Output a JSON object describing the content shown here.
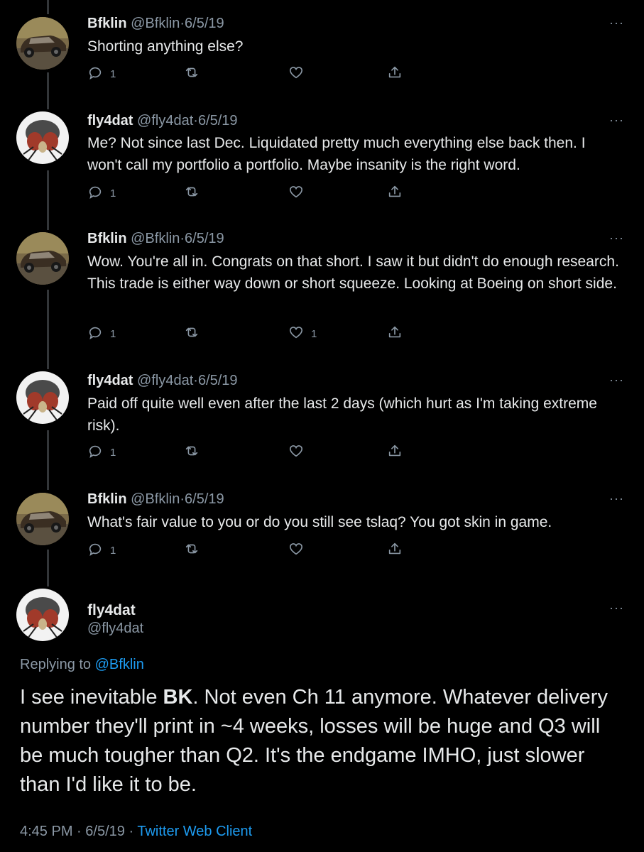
{
  "tweets": [
    {
      "name": "Bfklin",
      "handle": "@Bfklin",
      "date": "6/5/19",
      "text": "Shorting anything else?",
      "reply_count": "1",
      "retweet_count": "",
      "like_count": "",
      "avatar": "car"
    },
    {
      "name": "fly4dat",
      "handle": "@fly4dat",
      "date": "6/5/19",
      "text": "Me? Not since last Dec. Liquidated pretty much everything else back then. I won't call my portfolio a portfolio. Maybe insanity is the right word.",
      "reply_count": "1",
      "retweet_count": "",
      "like_count": "",
      "avatar": "fly"
    },
    {
      "name": "Bfklin",
      "handle": "@Bfklin",
      "date": "6/5/19",
      "text": "Wow. You're all in. Congrats on that short. I saw it but didn't do enough research. This trade is either way down or short squeeze. Looking at Boeing on short side.",
      "reply_count": "1",
      "retweet_count": "",
      "like_count": "1",
      "avatar": "car"
    },
    {
      "name": "fly4dat",
      "handle": "@fly4dat",
      "date": "6/5/19",
      "text": "Paid off quite well even after the last 2 days (which hurt as I'm taking extreme risk).",
      "reply_count": "1",
      "retweet_count": "",
      "like_count": "",
      "avatar": "fly"
    },
    {
      "name": "Bfklin",
      "handle": "@Bfklin",
      "date": "6/5/19",
      "text": "What's fair value to you or do you still see tslaq? You got skin in game.",
      "reply_count": "1",
      "retweet_count": "",
      "like_count": "",
      "avatar": "car"
    }
  ],
  "main_tweet": {
    "name": "fly4dat",
    "handle": "@fly4dat",
    "replying_prefix": "Replying to",
    "replying_to": "@Bfklin",
    "text_before": "I see inevitable ",
    "text_bold": "BK",
    "text_after": ". Not even Ch 11 anymore. Whatever delivery number they'll print in ~4 weeks, losses will be huge and Q3 will be much tougher than Q2. It's the endgame IMHO, just slower than I'd like it to be.",
    "time": "4:45 PM",
    "date": "6/5/19",
    "client": "Twitter Web Client"
  },
  "ui": {
    "more_glyph": "···",
    "dot": "·"
  },
  "colors": {
    "background": "#000000",
    "text": "#e7e9ea",
    "secondary": "#8b98a5",
    "link": "#1d9bf0",
    "thread_line": "#333639"
  }
}
